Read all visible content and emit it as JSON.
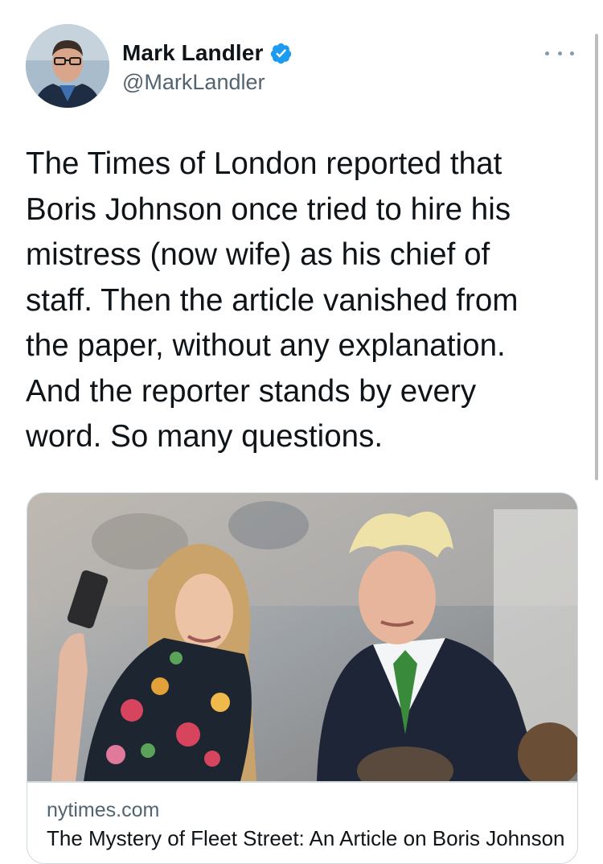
{
  "author": {
    "display_name": "Mark Landler",
    "handle": "@MarkLandler",
    "verified": true,
    "verified_color": "#1d9bf0"
  },
  "more_icon": "more-horizontal-icon",
  "tweet": {
    "lines": [
      "The Times of London reported that",
      "Boris Johnson once tried to hire his",
      "mistress (now wife) as his chief of",
      "staff. Then the article vanished from",
      "the paper, without any explanation.",
      "And the reporter stands by every",
      "word. So many questions."
    ]
  },
  "link_card": {
    "domain": "nytimes.com",
    "title": "The Mystery of Fleet Street: An Article on Boris Johnson"
  }
}
